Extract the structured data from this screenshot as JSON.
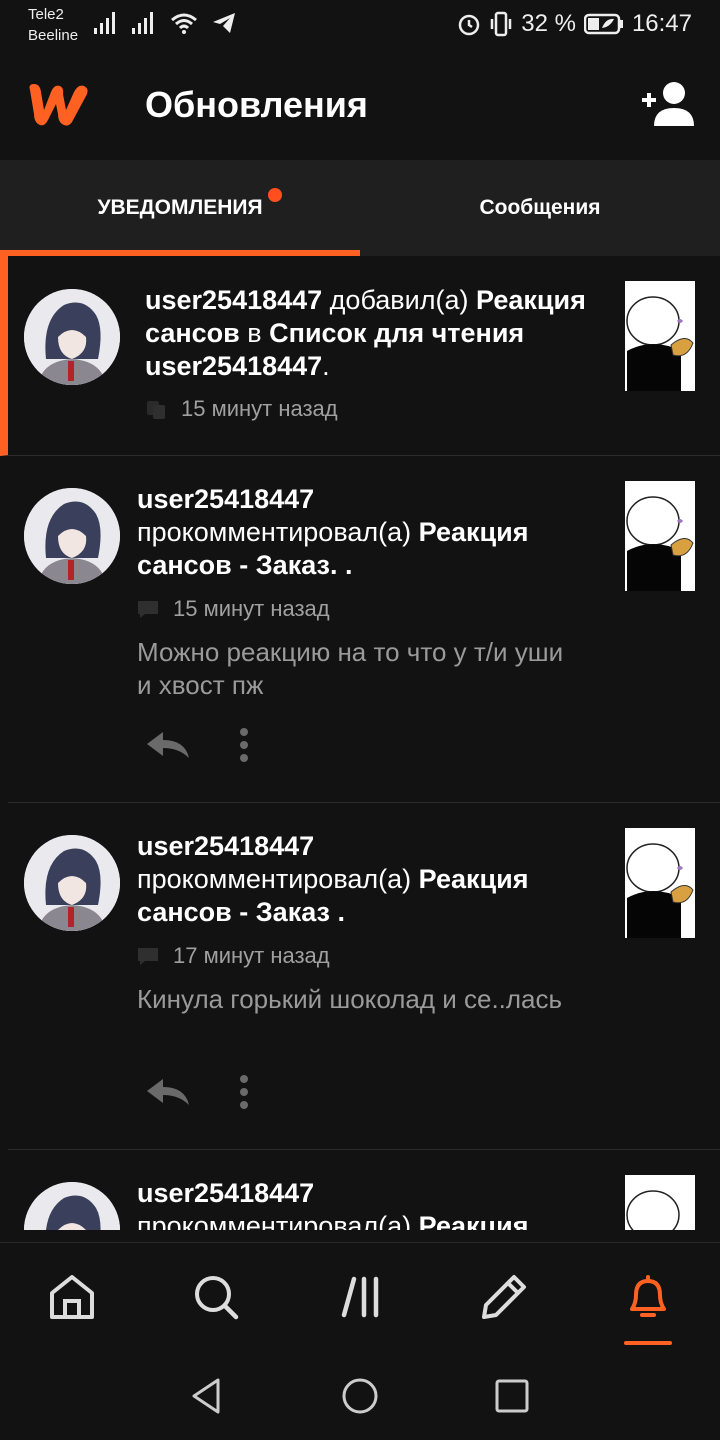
{
  "status_bar": {
    "carrier1": "Tele2",
    "carrier2": "Beeline",
    "battery": "32 %",
    "time": "16:47"
  },
  "header": {
    "title": "Обновления"
  },
  "tabs": [
    {
      "label": "УВЕДОМЛЕНИЯ",
      "active": true,
      "has_dot": true
    },
    {
      "label": "Сообщения",
      "active": false
    }
  ],
  "notifications": [
    {
      "user": "user25418447",
      "action": " добавил(а) ",
      "target": "Реакция сансов",
      "suffix": " в ",
      "target2": "Список для чтения user25418447",
      "end": ".",
      "time": "15 минут назад",
      "highlight": true
    },
    {
      "user": "user25418447",
      "action": "прокомментировал(а) ",
      "target": "Реакция сансов - Заказ. .",
      "time": "15 минут назад",
      "comment": "Можно реакцию на то что у т/и уши и хвост пж"
    },
    {
      "user": "user25418447",
      "action": "прокомментировал(а) ",
      "target": "Реакция сансов - Заказ .",
      "time": "17 минут назад",
      "comment": "Кинула горький шоколад и се..лась"
    },
    {
      "user": "user25418447",
      "action": "прокомментировал(а) ",
      "target": "Реакция"
    }
  ],
  "bottom_nav": [
    "home-icon",
    "search-icon",
    "library-icon",
    "write-icon",
    "notifications-icon"
  ],
  "colors": {
    "accent": "#ff6122",
    "background": "#121212",
    "tabs_bg": "#1f1f1f",
    "muted_text": "#9a9a9a"
  }
}
